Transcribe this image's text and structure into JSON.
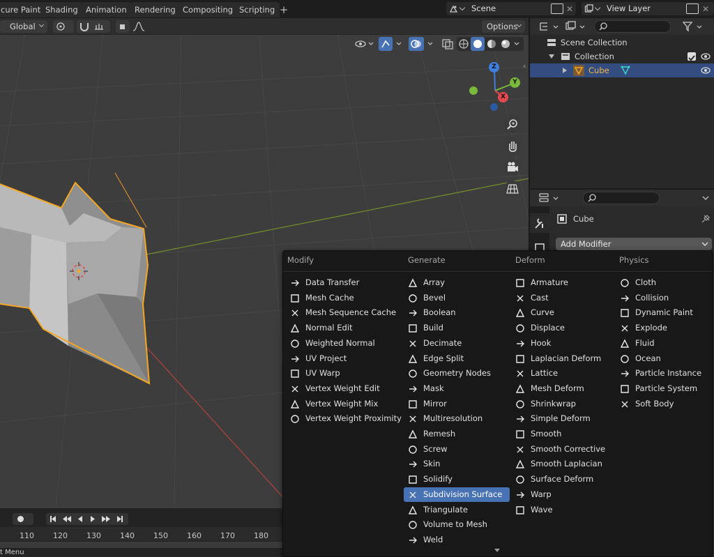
{
  "topbar": {
    "tabs": [
      "cure Paint",
      "Shading",
      "Animation",
      "Rendering",
      "Compositing",
      "Scripting"
    ],
    "scene": "Scene",
    "view_layer": "View Layer"
  },
  "viewport": {
    "orientation": "Global",
    "options_label": "Options"
  },
  "gizmo": {
    "z": "Z",
    "y": "Y",
    "x": "X"
  },
  "timeline": {
    "frames": [
      "110",
      "120",
      "130",
      "140",
      "150",
      "160",
      "170",
      "180"
    ]
  },
  "status": {
    "text": "t Menu"
  },
  "outliner": {
    "rows": [
      {
        "label": "Scene Collection"
      },
      {
        "label": "Collection"
      },
      {
        "label": "Cube"
      }
    ]
  },
  "properties": {
    "object_name": "Cube",
    "add_modifier_label": "Add Modifier"
  },
  "menu": {
    "columns": [
      {
        "title": "Modify",
        "items": [
          {
            "label": "Data Transfer",
            "icon": "data-transfer-icon"
          },
          {
            "label": "Mesh Cache",
            "icon": "mesh-cache-icon"
          },
          {
            "label": "Mesh Sequence Cache",
            "icon": "mesh-sequence-cache-icon"
          },
          {
            "label": "Normal Edit",
            "icon": "normal-edit-icon"
          },
          {
            "label": "Weighted Normal",
            "icon": "weighted-normal-icon"
          },
          {
            "label": "UV Project",
            "icon": "uv-project-icon"
          },
          {
            "label": "UV Warp",
            "icon": "uv-warp-icon"
          },
          {
            "label": "Vertex Weight Edit",
            "icon": "vertex-weight-edit-icon"
          },
          {
            "label": "Vertex Weight Mix",
            "icon": "vertex-weight-mix-icon"
          },
          {
            "label": "Vertex Weight Proximity",
            "icon": "vertex-weight-proximity-icon"
          }
        ]
      },
      {
        "title": "Generate",
        "items": [
          {
            "label": "Array",
            "icon": "array-icon"
          },
          {
            "label": "Bevel",
            "icon": "bevel-icon"
          },
          {
            "label": "Boolean",
            "icon": "boolean-icon"
          },
          {
            "label": "Build",
            "icon": "build-icon"
          },
          {
            "label": "Decimate",
            "icon": "decimate-icon"
          },
          {
            "label": "Edge Split",
            "icon": "edge-split-icon"
          },
          {
            "label": "Geometry Nodes",
            "icon": "geometry-nodes-icon"
          },
          {
            "label": "Mask",
            "icon": "mask-icon"
          },
          {
            "label": "Mirror",
            "icon": "mirror-icon"
          },
          {
            "label": "Multiresolution",
            "icon": "multiresolution-icon"
          },
          {
            "label": "Remesh",
            "icon": "remesh-icon"
          },
          {
            "label": "Screw",
            "icon": "screw-icon"
          },
          {
            "label": "Skin",
            "icon": "skin-icon"
          },
          {
            "label": "Solidify",
            "icon": "solidify-icon"
          },
          {
            "label": "Subdivision Surface",
            "icon": "subdivision-surface-icon",
            "active": true
          },
          {
            "label": "Triangulate",
            "icon": "triangulate-icon"
          },
          {
            "label": "Volume to Mesh",
            "icon": "volume-to-mesh-icon"
          },
          {
            "label": "Weld",
            "icon": "weld-icon"
          }
        ]
      },
      {
        "title": "Deform",
        "items": [
          {
            "label": "Armature",
            "icon": "armature-icon"
          },
          {
            "label": "Cast",
            "icon": "cast-icon"
          },
          {
            "label": "Curve",
            "icon": "curve-icon"
          },
          {
            "label": "Displace",
            "icon": "displace-icon"
          },
          {
            "label": "Hook",
            "icon": "hook-icon"
          },
          {
            "label": "Laplacian Deform",
            "icon": "laplacian-deform-icon"
          },
          {
            "label": "Lattice",
            "icon": "lattice-icon"
          },
          {
            "label": "Mesh Deform",
            "icon": "mesh-deform-icon"
          },
          {
            "label": "Shrinkwrap",
            "icon": "shrinkwrap-icon"
          },
          {
            "label": "Simple Deform",
            "icon": "simple-deform-icon"
          },
          {
            "label": "Smooth",
            "icon": "smooth-icon"
          },
          {
            "label": "Smooth Corrective",
            "icon": "smooth-corrective-icon"
          },
          {
            "label": "Smooth Laplacian",
            "icon": "smooth-laplacian-icon"
          },
          {
            "label": "Surface Deform",
            "icon": "surface-deform-icon"
          },
          {
            "label": "Warp",
            "icon": "warp-icon"
          },
          {
            "label": "Wave",
            "icon": "wave-icon"
          }
        ]
      },
      {
        "title": "Physics",
        "items": [
          {
            "label": "Cloth",
            "icon": "cloth-icon"
          },
          {
            "label": "Collision",
            "icon": "collision-icon"
          },
          {
            "label": "Dynamic Paint",
            "icon": "dynamic-paint-icon"
          },
          {
            "label": "Explode",
            "icon": "explode-icon"
          },
          {
            "label": "Fluid",
            "icon": "fluid-icon"
          },
          {
            "label": "Ocean",
            "icon": "ocean-icon"
          },
          {
            "label": "Particle Instance",
            "icon": "particle-instance-icon"
          },
          {
            "label": "Particle System",
            "icon": "particle-system-icon"
          },
          {
            "label": "Soft Body",
            "icon": "soft-body-icon"
          }
        ]
      }
    ]
  },
  "colors": {
    "accent": "#4772b3",
    "selection_outline": "#f5a623",
    "axis_x": "#e5484d",
    "axis_y": "#7ab83c",
    "axis_z": "#3f7fe0"
  }
}
